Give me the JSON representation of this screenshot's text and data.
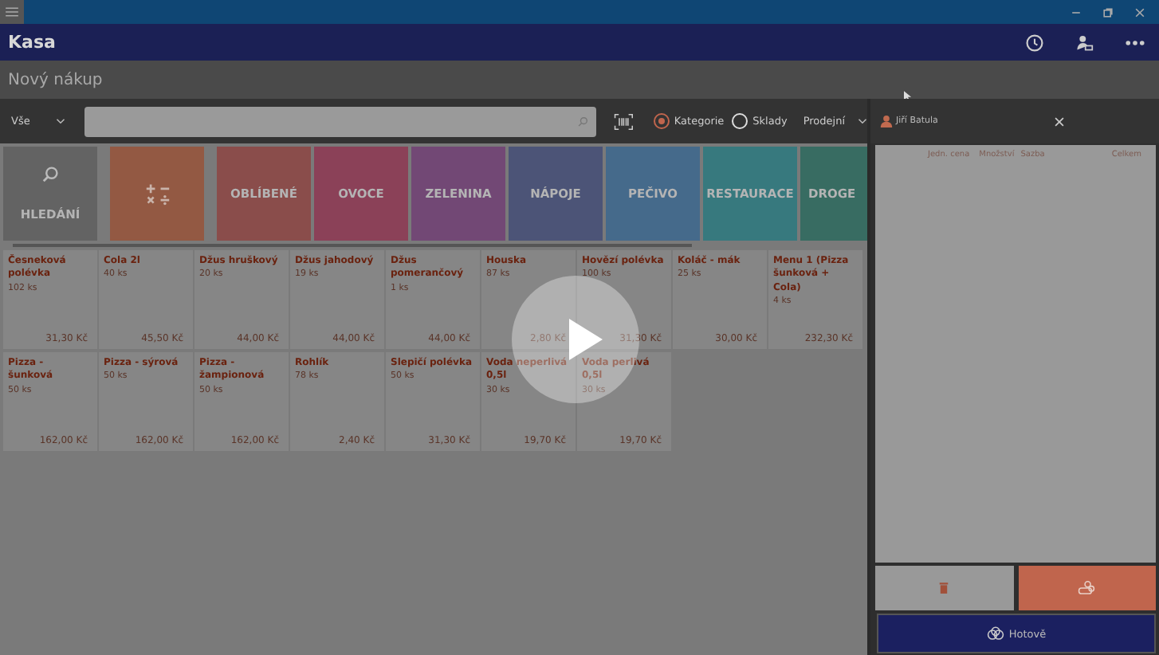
{
  "window": {
    "title": "Kasa"
  },
  "subtitle": "Nový nákup",
  "toolbar": {
    "filter": "Vše",
    "modes": [
      {
        "label": "Kategorie",
        "selected": true
      },
      {
        "label": "Sklady",
        "selected": false
      }
    ],
    "price_list": "Prodejní"
  },
  "categories": [
    {
      "kind": "search",
      "label": "HLEDÁNÍ",
      "color": "#636363"
    },
    {
      "kind": "calc",
      "color": "#935943"
    },
    {
      "kind": "tile",
      "label": "OBLÍBENÉ",
      "color": "#8a4d4b"
    },
    {
      "kind": "tile",
      "label": "OVOCE",
      "color": "#8b4158"
    },
    {
      "kind": "tile",
      "label": "ZELENINA",
      "color": "#724875"
    },
    {
      "kind": "tile",
      "label": "NÁPOJE",
      "color": "#4c5477"
    },
    {
      "kind": "tile",
      "label": "PEČIVO",
      "color": "#456a8b"
    },
    {
      "kind": "tile",
      "label": "RESTAURACE",
      "color": "#37797e"
    },
    {
      "kind": "tile",
      "label": "DROGE",
      "color": "#386c62"
    }
  ],
  "products": [
    {
      "name": "Česneková polévka",
      "stock": "102 ks",
      "price": "31,30 Kč"
    },
    {
      "name": "Cola 2l",
      "stock": "40 ks",
      "price": "45,50 Kč"
    },
    {
      "name": "Džus hruškový",
      "stock": "20 ks",
      "price": "44,00 Kč"
    },
    {
      "name": "Džus jahodový",
      "stock": "19 ks",
      "price": "44,00 Kč"
    },
    {
      "name": "Džus pomerančový",
      "stock": "1 ks",
      "price": "44,00 Kč"
    },
    {
      "name": "Houska",
      "stock": "87 ks",
      "price": "2,80 Kč"
    },
    {
      "name": "Hovězí polévka",
      "stock": "100 ks",
      "price": "31,30 Kč"
    },
    {
      "name": "Koláč - mák",
      "stock": "25 ks",
      "price": "30,00 Kč"
    },
    {
      "name": "Menu 1 (Pizza šunková + Cola)",
      "stock": "4 ks",
      "price": "232,30 Kč"
    },
    {
      "name": "Pizza - šunková",
      "stock": "50 ks",
      "price": "162,00 Kč"
    },
    {
      "name": "Pizza - sýrová",
      "stock": "50 ks",
      "price": "162,00 Kč"
    },
    {
      "name": "Pizza - žampionová",
      "stock": "50 ks",
      "price": "162,00 Kč"
    },
    {
      "name": "Rohlík",
      "stock": "78 ks",
      "price": "2,40 Kč"
    },
    {
      "name": "Slepičí polévka",
      "stock": "50 ks",
      "price": "31,30 Kč"
    },
    {
      "name": "Voda neperlivá 0,5l",
      "stock": "30 ks",
      "price": "19,70 Kč"
    },
    {
      "name": "Voda perlivá 0,5l",
      "stock": "30 ks",
      "price": "19,70 Kč"
    }
  ],
  "cart": {
    "user": "Jiří Batula",
    "columns": [
      "Jedn. cena",
      "Množství",
      "Sazba",
      "Celkem"
    ],
    "pay_button": "Hotově"
  }
}
